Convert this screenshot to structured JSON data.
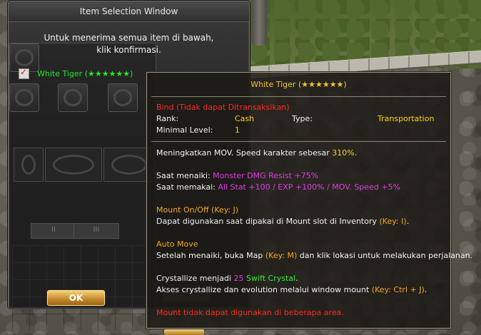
{
  "window": {
    "title": "Item Selection Window",
    "message_line1": "Untuk menerima semua item di bawah,",
    "message_line2": "klik konfirmasi.",
    "item": {
      "name": "White Tiger (★★★★★★)",
      "checked": true
    },
    "ok_label": "OK"
  },
  "tooltip": {
    "title": "White Tiger (★★★★★★)",
    "bind": "Bind (Tidak dapat Ditransaksikan)",
    "rank_label": "Rank:",
    "rank_value": "Cash",
    "type_label": "Type:",
    "type_value": "Transportation",
    "min_level_label": "Minimal Level:",
    "min_level_value": "1",
    "desc_prefix": "Meningkatkan MOV. Speed karakter sebesar ",
    "desc_value": "310%.",
    "ride_label": "Saat menaiki: ",
    "ride_value": "Monster DMG Resist +75%",
    "equip_label": "Saat memakai: ",
    "equip_value": "All Stat +100 / EXP +100% / MOV. Speed +5%",
    "mount_heading": "Mount On/Off (Key: J)",
    "mount_desc": "Dapat digunakan saat dipakai di Mount slot di Inventory ",
    "mount_key": "(Key: I)",
    "mount_end": ".",
    "auto_heading": "Auto Move",
    "auto_desc1": "Setelah menaiki, buka Map ",
    "auto_key": "(Key: M)",
    "auto_desc2": " dan klik lokasi untuk melakukan perjalanan.",
    "crys_prefix": "Crystallize menjadi ",
    "crys_count": "25",
    "crys_item": "Swift Crystal",
    "crys_end": ".",
    "crys_line2": "Akses crystallize dan evolution melalui window mount ",
    "crys_key": "(Key: Ctrl + J)",
    "crys_line2_end": ".",
    "warning": "Mount tidak dapat digunakan di beberapa area."
  },
  "colors": {
    "title_gold": "#f3c53c",
    "bind_red": "#ff2a1a",
    "value_yellow": "#ffd020",
    "heading_orange": "#f6a623",
    "stat_magenta": "#e03ae6",
    "crystal_green": "#3ee63e",
    "item_green": "#28e628"
  }
}
